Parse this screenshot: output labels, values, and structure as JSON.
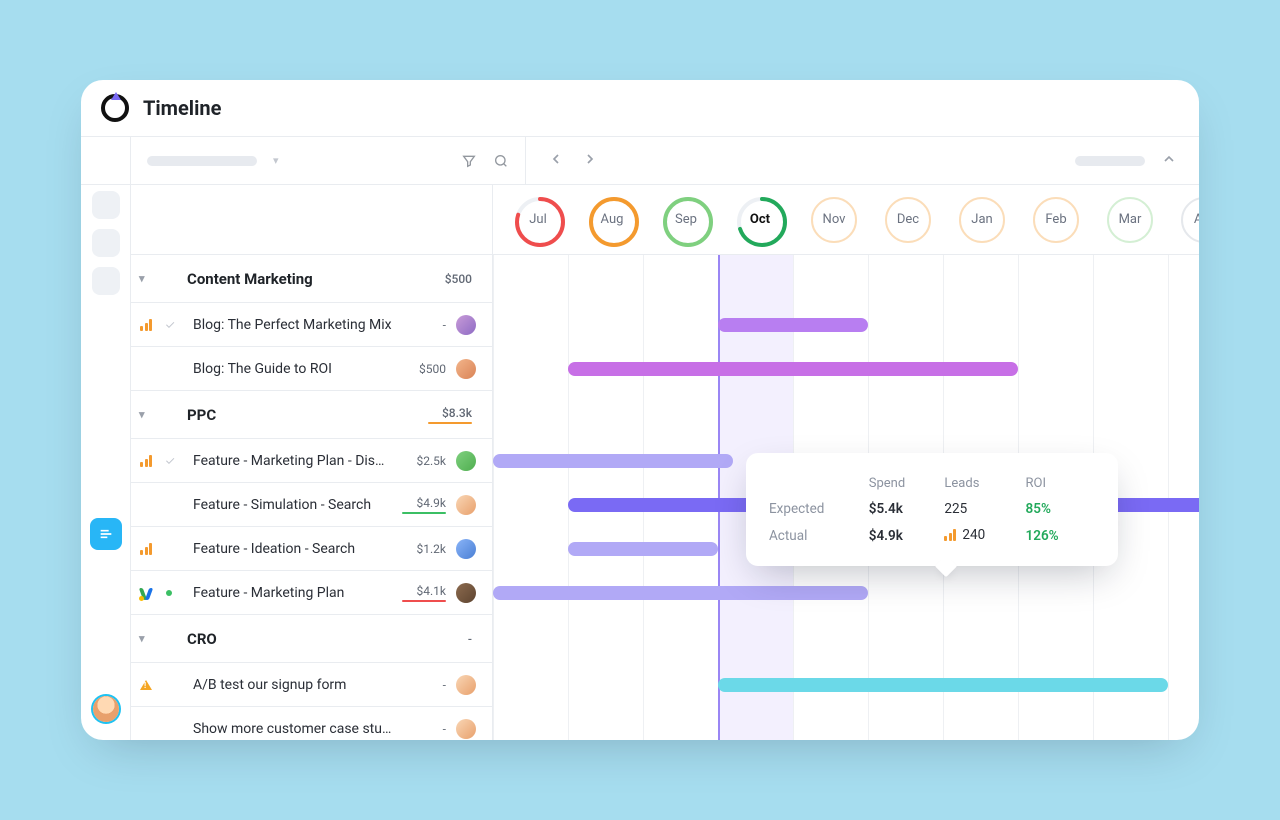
{
  "page": {
    "title": "Timeline"
  },
  "timeline": {
    "months": [
      {
        "label": "Jul",
        "style": "partial",
        "color": "#ef4d4d",
        "pct": 80,
        "active": false
      },
      {
        "label": "Aug",
        "style": "ring",
        "color": "#f49a2e",
        "pct": 100,
        "active": false
      },
      {
        "label": "Sep",
        "style": "ring",
        "color": "#7fd07f",
        "pct": 100,
        "active": false
      },
      {
        "label": "Oct",
        "style": "partial",
        "color": "#22a95b",
        "pct": 70,
        "active": true
      },
      {
        "label": "Nov",
        "style": "outline",
        "color": "#f49a2e"
      },
      {
        "label": "Dec",
        "style": "outline",
        "color": "#f49a2e"
      },
      {
        "label": "Jan",
        "style": "outline",
        "color": "#f49a2e"
      },
      {
        "label": "Feb",
        "style": "outline",
        "color": "#f49a2e"
      },
      {
        "label": "Mar",
        "style": "outline",
        "color": "#7fd07f"
      },
      {
        "label": "Apr",
        "style": "outline-cut",
        "color": "#e5e8ec"
      }
    ],
    "current_index": 3
  },
  "groups": [
    {
      "name": "Content Marketing",
      "amount": "$500",
      "tasks": [
        {
          "name": "Blog: The Perfect Marketing Mix",
          "amount": "-",
          "icon": "analytics",
          "checked": true,
          "avatar": "av-1",
          "bar": {
            "start": 3.0,
            "span": 2.0,
            "color": "#b87ef1"
          }
        },
        {
          "name": "Blog: The Guide to ROI",
          "amount": "$500",
          "avatar": "av-2",
          "bar": {
            "start": 1.0,
            "span": 6.0,
            "color": "#c76fe6"
          }
        }
      ]
    },
    {
      "name": "PPC",
      "amount": "$8.3k",
      "underline": "#f49a2e",
      "tasks": [
        {
          "name": "Feature - Marketing Plan - Display",
          "amount": "$2.5k",
          "icon": "analytics",
          "checked": true,
          "avatar": "av-3",
          "bar": {
            "start": 0.0,
            "span": 3.2,
            "color": "#b1a9f6"
          }
        },
        {
          "name": "Feature - Simulation - Search",
          "amount": "$4.9k",
          "underline": "#3bbf64",
          "avatar": "av-b",
          "bar": {
            "start": 1.0,
            "span": 9.5,
            "color": "#7a6af4"
          }
        },
        {
          "name": "Feature - Ideation - Search",
          "amount": "$1.2k",
          "icon": "analytics",
          "avatar": "av-4",
          "bar": {
            "start": 1.0,
            "span": 2.0,
            "color": "#b1a9f6"
          }
        },
        {
          "name": "Feature - Marketing Plan",
          "amount": "$4.1k",
          "underline": "#ef4d4d",
          "icon": "adwords",
          "status": "green",
          "avatar": "av-5",
          "bar": {
            "start": 0.0,
            "span": 5.0,
            "color": "#b1a9f6"
          }
        }
      ]
    },
    {
      "name": "CRO",
      "amount": "-",
      "tasks": [
        {
          "name": "A/B test our signup form",
          "amount": "-",
          "icon": "warn",
          "avatar": "av-b",
          "bar": {
            "start": 3.0,
            "span": 6.0,
            "color": "#6bd9e8"
          }
        },
        {
          "name": "Show more customer case studies",
          "amount": "-",
          "avatar": "av-b"
        }
      ]
    }
  ],
  "tooltip": {
    "headers": {
      "col1": "",
      "spend": "Spend",
      "leads": "Leads",
      "roi": "ROI"
    },
    "rows": [
      {
        "label": "Expected",
        "spend": "$5.4k",
        "leads": "225",
        "roi": "85%"
      },
      {
        "label": "Actual",
        "spend": "$4.9k",
        "leads": "240",
        "roi": "126%",
        "leads_icon": true
      }
    ]
  }
}
